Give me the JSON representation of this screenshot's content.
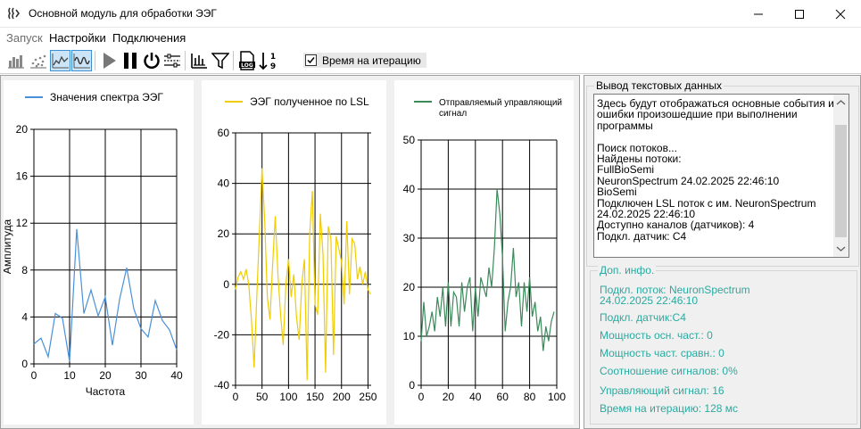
{
  "window": {
    "title": "Основной модуль для обработки ЭЭГ",
    "icon": "brain-icon"
  },
  "menu": {
    "items": [
      {
        "label": "Запуск",
        "disabled": true
      },
      {
        "label": "Настройки",
        "disabled": false
      },
      {
        "label": "Подключения",
        "disabled": false
      }
    ]
  },
  "toolbar": {
    "iteration_time_label": "Время на итерацию",
    "iteration_time_checked": true,
    "buttons": [
      {
        "icon": "bar-chart-icon",
        "active": false
      },
      {
        "icon": "scatter-icon",
        "active": false
      },
      {
        "icon": "line-chart-icon",
        "active": true
      },
      {
        "icon": "waveform-icon",
        "active": true
      },
      {
        "icon": "play-icon",
        "active": false
      },
      {
        "icon": "pause-icon",
        "active": false
      },
      {
        "icon": "power-icon",
        "active": false
      },
      {
        "icon": "mixer-icon",
        "active": false
      },
      {
        "icon": "spectrum-icon",
        "active": false
      },
      {
        "icon": "filter-icon",
        "active": false
      },
      {
        "icon": "log-file-icon",
        "active": false
      },
      {
        "icon": "sort-numeric-icon",
        "active": false
      }
    ]
  },
  "chart_data": [
    {
      "type": "line",
      "legend": "Значения спектра ЭЭГ",
      "xlabel": "Частота",
      "ylabel": "Амплитуда",
      "color": "#4a90d9",
      "xlim": [
        0,
        40
      ],
      "ylim": [
        0,
        20
      ],
      "xticks": [
        0,
        10,
        20,
        30,
        40
      ],
      "yticks": [
        0,
        4,
        8,
        12,
        16,
        20
      ],
      "x": [
        0,
        2,
        4,
        6,
        8,
        10,
        12,
        14,
        16,
        18,
        20,
        22,
        24,
        26,
        28,
        30,
        32,
        34,
        36,
        38,
        40
      ],
      "y": [
        1.7,
        2.2,
        0.6,
        4.3,
        3.9,
        0.2,
        11.5,
        4.3,
        6.3,
        4.1,
        5.7,
        1.6,
        5.5,
        8.2,
        4.7,
        3.0,
        2.3,
        5.4,
        3.7,
        2.9,
        1.2
      ]
    },
    {
      "type": "line",
      "legend": "ЭЭГ полученное по LSL",
      "color": "#f0cc00",
      "xlim": [
        0,
        256
      ],
      "ylim": [
        -40,
        60
      ],
      "xticks": [
        0,
        50,
        100,
        150,
        200,
        250
      ],
      "yticks": [
        -40,
        -20,
        0,
        20,
        40,
        60
      ],
      "x": [
        0,
        5,
        10,
        15,
        20,
        25,
        30,
        35,
        40,
        45,
        50,
        55,
        60,
        65,
        70,
        75,
        80,
        85,
        90,
        95,
        100,
        105,
        110,
        115,
        120,
        125,
        130,
        135,
        140,
        145,
        150,
        155,
        160,
        165,
        170,
        175,
        180,
        185,
        190,
        195,
        200,
        205,
        210,
        215,
        220,
        225,
        230,
        235,
        240,
        245,
        250,
        255
      ],
      "y": [
        -2,
        3,
        5,
        2,
        6,
        0,
        -14,
        -33,
        -5,
        20,
        46,
        25,
        -5,
        -14,
        8,
        27,
        4,
        -12,
        -24,
        0,
        10,
        -5,
        4,
        -13,
        -22,
        0,
        10,
        -38,
        20,
        37,
        -8,
        -12,
        28,
        12,
        -35,
        23,
        18,
        -28,
        19,
        14,
        9,
        -8,
        25,
        -4,
        18,
        16,
        2,
        7,
        0,
        5,
        -2,
        -4
      ]
    },
    {
      "type": "line",
      "legend": "Отправляемый управляющий сигнал",
      "color": "#3a8a5a",
      "xlim": [
        0,
        100
      ],
      "ylim": [
        0,
        50
      ],
      "xticks": [
        0,
        20,
        40,
        60,
        80,
        100
      ],
      "yticks": [
        0,
        10,
        20,
        30,
        40,
        50
      ],
      "x": [
        0,
        2,
        4,
        6,
        8,
        10,
        12,
        14,
        16,
        18,
        20,
        22,
        24,
        26,
        28,
        30,
        32,
        34,
        36,
        38,
        40,
        42,
        44,
        46,
        48,
        50,
        52,
        54,
        56,
        58,
        60,
        62,
        64,
        66,
        68,
        70,
        72,
        74,
        76,
        78,
        80,
        82,
        84,
        86,
        88,
        90,
        92,
        94,
        96,
        98
      ],
      "y": [
        9,
        17,
        10,
        12,
        15,
        11,
        18,
        14,
        20,
        12,
        21,
        12,
        19,
        18,
        12,
        21,
        15,
        20,
        22,
        11,
        20,
        14,
        22,
        20,
        18,
        24,
        20,
        28,
        40,
        35,
        26,
        11,
        17,
        20,
        28,
        18,
        21,
        12,
        21,
        15,
        22,
        14,
        17,
        11,
        14,
        7,
        12,
        9,
        13,
        15
      ]
    }
  ],
  "log": {
    "title": "Вывод текстовых данных",
    "lines": [
      "Здесь будут отображаться основные события и",
      "ошибки произошедшие при выполнении",
      "программы",
      "",
      "Поиск потоков...",
      "Найдены потоки:",
      "FullBioSemi",
      "NeuronSpectrum 24.02.2025 22:46:10",
      "BioSemi",
      "Подключен LSL поток с им. NeuronSpectrum",
      "24.02.2025 22:46:10",
      "Доступно каналов (датчиков): 4",
      "Подкл. датчик: C4"
    ]
  },
  "info": {
    "title": "Доп. инфо.",
    "color": "#2aaaa0",
    "lines": [
      "Подкл. поток: NeuronSpectrum",
      "24.02.2025 22:46:10",
      "Подкл. датчик:C4",
      "Мощность осн. част.: 0",
      "Мощность част. сравн.: 0",
      "Соотношение сигналов: 0%",
      "Управляющий сигнал: 16",
      "Время на итерацию: 128 мс"
    ]
  }
}
